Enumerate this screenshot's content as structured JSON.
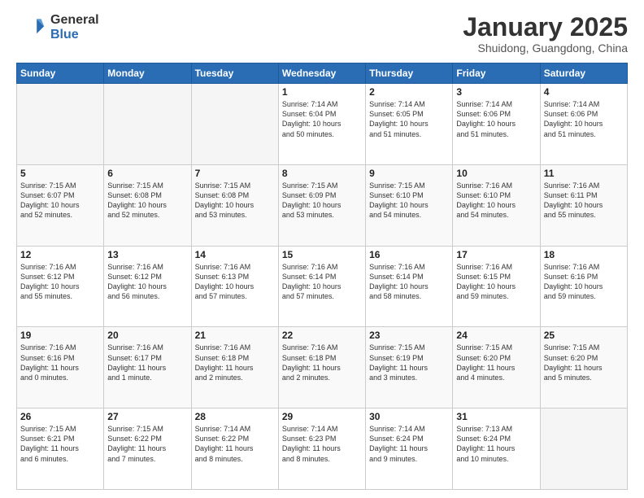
{
  "logo": {
    "general": "General",
    "blue": "Blue"
  },
  "header": {
    "title": "January 2025",
    "subtitle": "Shuidong, Guangdong, China"
  },
  "weekdays": [
    "Sunday",
    "Monday",
    "Tuesday",
    "Wednesday",
    "Thursday",
    "Friday",
    "Saturday"
  ],
  "weeks": [
    [
      {
        "day": "",
        "info": ""
      },
      {
        "day": "",
        "info": ""
      },
      {
        "day": "",
        "info": ""
      },
      {
        "day": "1",
        "info": "Sunrise: 7:14 AM\nSunset: 6:04 PM\nDaylight: 10 hours\nand 50 minutes."
      },
      {
        "day": "2",
        "info": "Sunrise: 7:14 AM\nSunset: 6:05 PM\nDaylight: 10 hours\nand 51 minutes."
      },
      {
        "day": "3",
        "info": "Sunrise: 7:14 AM\nSunset: 6:06 PM\nDaylight: 10 hours\nand 51 minutes."
      },
      {
        "day": "4",
        "info": "Sunrise: 7:14 AM\nSunset: 6:06 PM\nDaylight: 10 hours\nand 51 minutes."
      }
    ],
    [
      {
        "day": "5",
        "info": "Sunrise: 7:15 AM\nSunset: 6:07 PM\nDaylight: 10 hours\nand 52 minutes."
      },
      {
        "day": "6",
        "info": "Sunrise: 7:15 AM\nSunset: 6:08 PM\nDaylight: 10 hours\nand 52 minutes."
      },
      {
        "day": "7",
        "info": "Sunrise: 7:15 AM\nSunset: 6:08 PM\nDaylight: 10 hours\nand 53 minutes."
      },
      {
        "day": "8",
        "info": "Sunrise: 7:15 AM\nSunset: 6:09 PM\nDaylight: 10 hours\nand 53 minutes."
      },
      {
        "day": "9",
        "info": "Sunrise: 7:15 AM\nSunset: 6:10 PM\nDaylight: 10 hours\nand 54 minutes."
      },
      {
        "day": "10",
        "info": "Sunrise: 7:16 AM\nSunset: 6:10 PM\nDaylight: 10 hours\nand 54 minutes."
      },
      {
        "day": "11",
        "info": "Sunrise: 7:16 AM\nSunset: 6:11 PM\nDaylight: 10 hours\nand 55 minutes."
      }
    ],
    [
      {
        "day": "12",
        "info": "Sunrise: 7:16 AM\nSunset: 6:12 PM\nDaylight: 10 hours\nand 55 minutes."
      },
      {
        "day": "13",
        "info": "Sunrise: 7:16 AM\nSunset: 6:12 PM\nDaylight: 10 hours\nand 56 minutes."
      },
      {
        "day": "14",
        "info": "Sunrise: 7:16 AM\nSunset: 6:13 PM\nDaylight: 10 hours\nand 57 minutes."
      },
      {
        "day": "15",
        "info": "Sunrise: 7:16 AM\nSunset: 6:14 PM\nDaylight: 10 hours\nand 57 minutes."
      },
      {
        "day": "16",
        "info": "Sunrise: 7:16 AM\nSunset: 6:14 PM\nDaylight: 10 hours\nand 58 minutes."
      },
      {
        "day": "17",
        "info": "Sunrise: 7:16 AM\nSunset: 6:15 PM\nDaylight: 10 hours\nand 59 minutes."
      },
      {
        "day": "18",
        "info": "Sunrise: 7:16 AM\nSunset: 6:16 PM\nDaylight: 10 hours\nand 59 minutes."
      }
    ],
    [
      {
        "day": "19",
        "info": "Sunrise: 7:16 AM\nSunset: 6:16 PM\nDaylight: 11 hours\nand 0 minutes."
      },
      {
        "day": "20",
        "info": "Sunrise: 7:16 AM\nSunset: 6:17 PM\nDaylight: 11 hours\nand 1 minute."
      },
      {
        "day": "21",
        "info": "Sunrise: 7:16 AM\nSunset: 6:18 PM\nDaylight: 11 hours\nand 2 minutes."
      },
      {
        "day": "22",
        "info": "Sunrise: 7:16 AM\nSunset: 6:18 PM\nDaylight: 11 hours\nand 2 minutes."
      },
      {
        "day": "23",
        "info": "Sunrise: 7:15 AM\nSunset: 6:19 PM\nDaylight: 11 hours\nand 3 minutes."
      },
      {
        "day": "24",
        "info": "Sunrise: 7:15 AM\nSunset: 6:20 PM\nDaylight: 11 hours\nand 4 minutes."
      },
      {
        "day": "25",
        "info": "Sunrise: 7:15 AM\nSunset: 6:20 PM\nDaylight: 11 hours\nand 5 minutes."
      }
    ],
    [
      {
        "day": "26",
        "info": "Sunrise: 7:15 AM\nSunset: 6:21 PM\nDaylight: 11 hours\nand 6 minutes."
      },
      {
        "day": "27",
        "info": "Sunrise: 7:15 AM\nSunset: 6:22 PM\nDaylight: 11 hours\nand 7 minutes."
      },
      {
        "day": "28",
        "info": "Sunrise: 7:14 AM\nSunset: 6:22 PM\nDaylight: 11 hours\nand 8 minutes."
      },
      {
        "day": "29",
        "info": "Sunrise: 7:14 AM\nSunset: 6:23 PM\nDaylight: 11 hours\nand 8 minutes."
      },
      {
        "day": "30",
        "info": "Sunrise: 7:14 AM\nSunset: 6:24 PM\nDaylight: 11 hours\nand 9 minutes."
      },
      {
        "day": "31",
        "info": "Sunrise: 7:13 AM\nSunset: 6:24 PM\nDaylight: 11 hours\nand 10 minutes."
      },
      {
        "day": "",
        "info": ""
      }
    ]
  ]
}
